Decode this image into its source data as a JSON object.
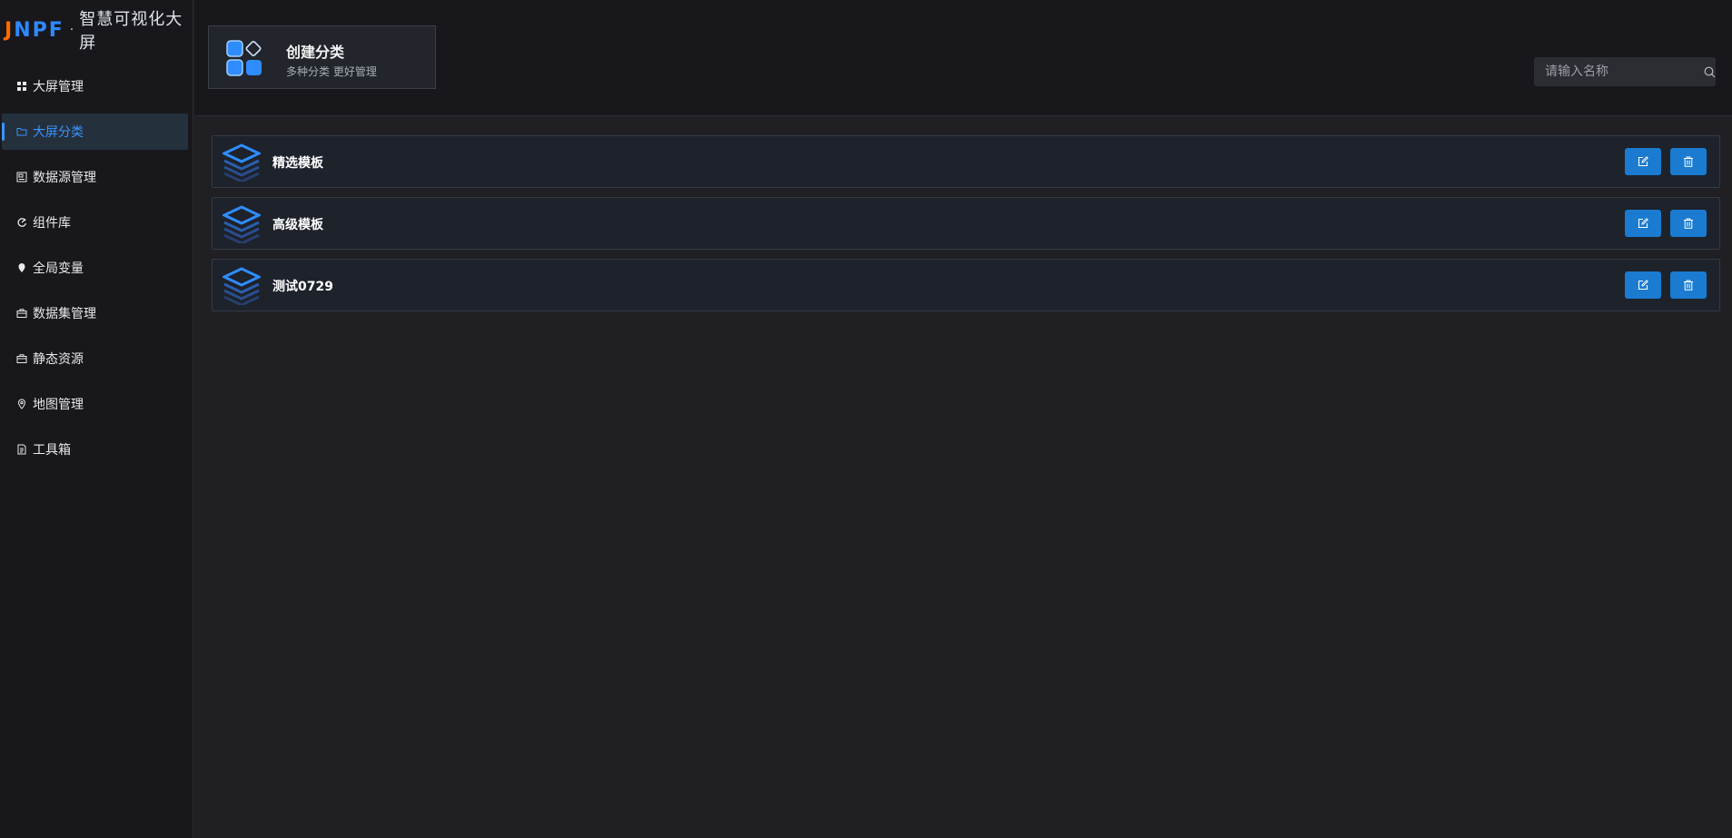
{
  "logo": {
    "mark_j": "J",
    "mark_npf": "NPF",
    "separator": "·",
    "title": "智慧可视化大屏"
  },
  "sidebar": {
    "items": [
      {
        "label": "大屏管理",
        "icon": "grid-icon"
      },
      {
        "label": "大屏分类",
        "icon": "folder-icon",
        "active": true
      },
      {
        "label": "数据源管理",
        "icon": "datasource-icon"
      },
      {
        "label": "组件库",
        "icon": "component-icon"
      },
      {
        "label": "全局变量",
        "icon": "location-pin-icon"
      },
      {
        "label": "数据集管理",
        "icon": "briefcase-icon"
      },
      {
        "label": "静态资源",
        "icon": "briefcase-icon"
      },
      {
        "label": "地图管理",
        "icon": "map-pin-icon"
      },
      {
        "label": "工具箱",
        "icon": "document-icon"
      }
    ]
  },
  "header": {
    "create": {
      "title": "创建分类",
      "subtitle": "多种分类 更好管理"
    },
    "search": {
      "placeholder": "请输入名称",
      "value": ""
    }
  },
  "categories": [
    {
      "name": "精选模板",
      "edit_icon": "edit-icon",
      "delete_icon": "trash-icon"
    },
    {
      "name": "高级模板",
      "edit_icon": "edit-icon",
      "delete_icon": "trash-icon"
    },
    {
      "name": "测试0729",
      "edit_icon": "edit-icon",
      "delete_icon": "trash-icon"
    }
  ],
  "colors": {
    "accent": "#3894ff",
    "button": "#1a7bd0",
    "logo_orange": "#ff6a00",
    "logo_blue": "#2f88ff"
  }
}
